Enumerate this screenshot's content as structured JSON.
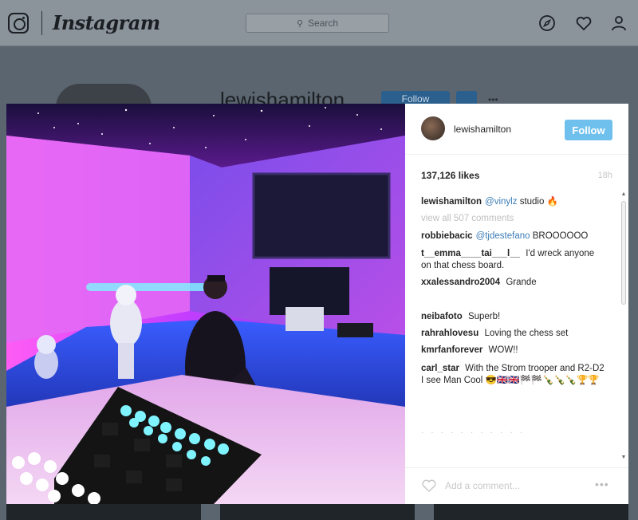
{
  "topbar": {
    "wordmark": "Instagram",
    "search_placeholder": "Search",
    "icons": [
      "instagram-logo-icon",
      "compass-icon",
      "heart-icon",
      "person-icon"
    ]
  },
  "background_profile": {
    "username": "lewishamilton",
    "follow_label": "Follow",
    "more": "•••"
  },
  "post": {
    "username": "lewishamilton",
    "follow_label": "Follow",
    "likes": "137,126 likes",
    "time": "18h",
    "caption": {
      "user": "lewishamilton",
      "mention": "@vinylz",
      "text": "studio 🔥"
    },
    "view_all": "view all 507 comments",
    "comments": [
      {
        "user": "robbiebacic",
        "mention": "@tjdestefano",
        "text": "BROOOOOO"
      },
      {
        "user": "t__emma____tai___l__",
        "mention": "",
        "text": "I'd wreck anyone on that chess board."
      },
      {
        "user": "xxalessandro2004",
        "mention": "",
        "text": "Grande"
      },
      {
        "user": "neibafoto",
        "mention": "",
        "text": "Superb!"
      },
      {
        "user": "rahrahlovesu",
        "mention": "",
        "text": "Loving the chess set"
      },
      {
        "user": "kmrfanforever",
        "mention": "",
        "text": "WOW!!"
      },
      {
        "user": "carl_star",
        "mention": "",
        "text": "With the Strom trooper and R2-D2 I see Man Cool 😎🇬🇧🇬🇧🏁🏁🍾🍾🍾🏆🏆"
      }
    ],
    "faint_line_1": ". . . . . . . . . . .",
    "faint_line_2": ". . . . . . . . . . . . . . .",
    "add_comment_placeholder": "Add a comment...",
    "more": "•••"
  },
  "colors": {
    "follow_button": "#70c0ee",
    "mention": "#3b7cb5",
    "overlay": "#5b6570"
  }
}
